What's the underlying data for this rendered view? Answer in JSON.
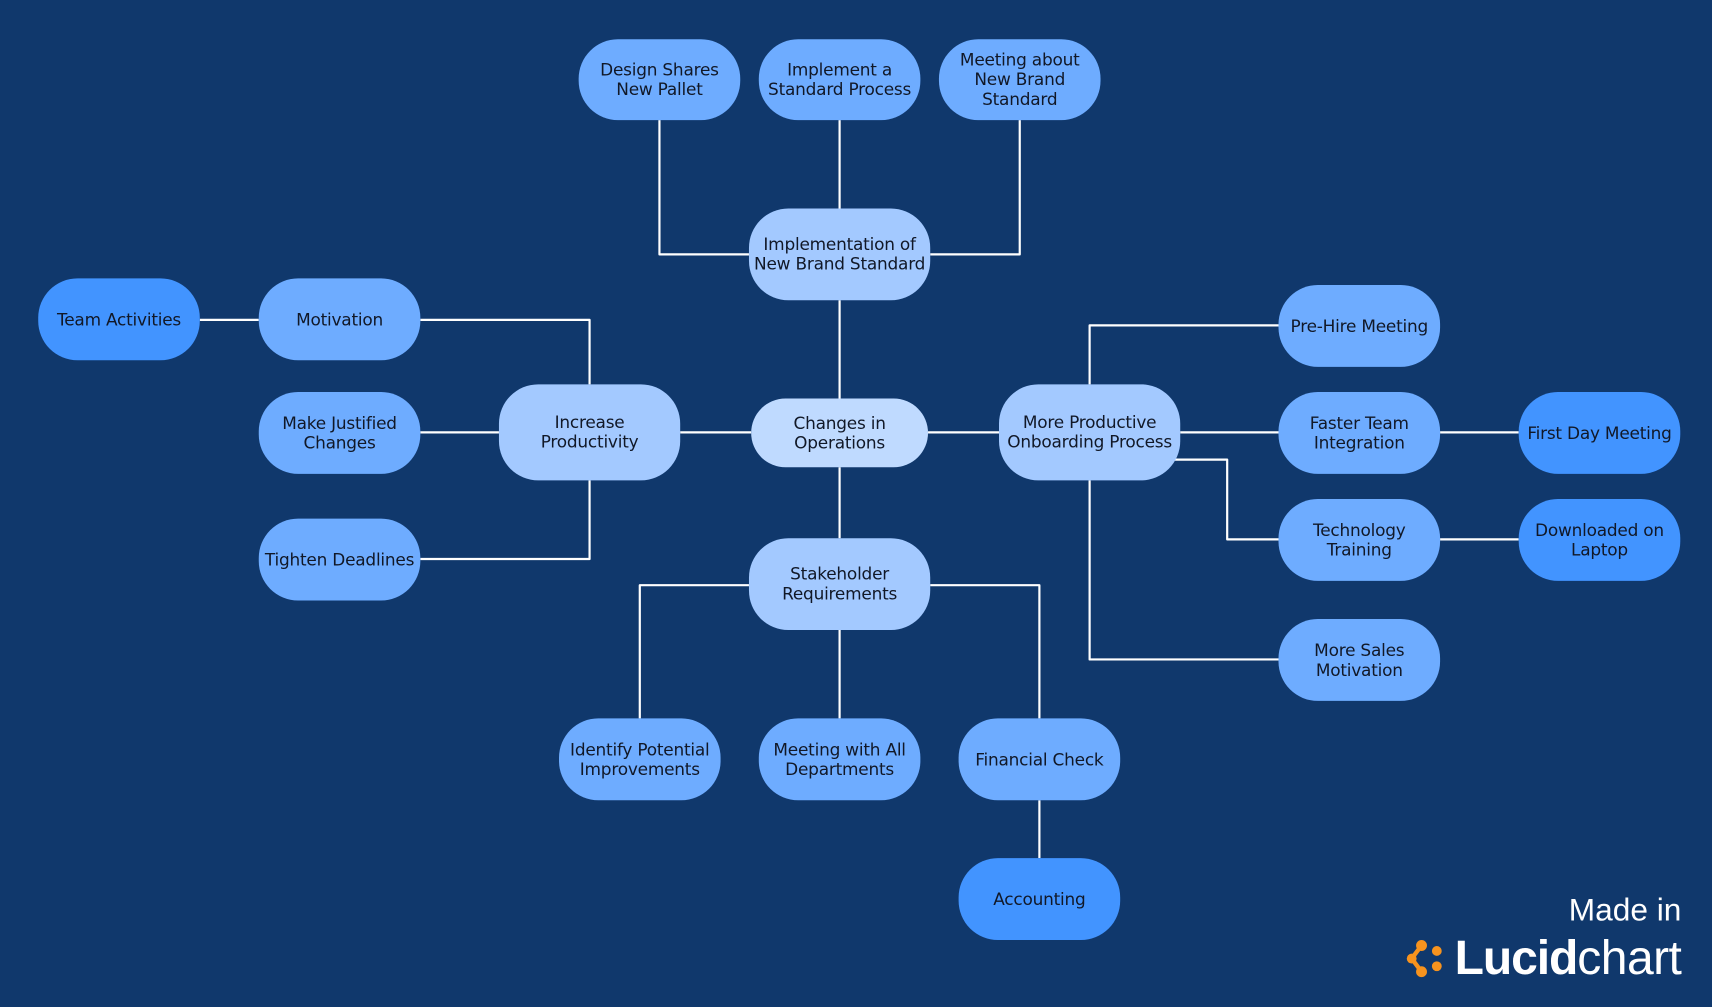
{
  "diagram": {
    "type": "mind-map",
    "colors": {
      "background": "#10386c",
      "connector": "#ffffff",
      "level0": "#bfdaff",
      "level1": "#a3c9ff",
      "level2": "#6eacff",
      "level3": "#4294ff",
      "logo_accent": "#f7931e"
    },
    "nodes": [
      {
        "id": "changes",
        "label": "Changes in\nOperations",
        "level": 0
      },
      {
        "id": "impl_brand",
        "label": "Implementation of\nNew Brand Standard",
        "level": 1
      },
      {
        "id": "design_pallet",
        "label": "Design Shares\nNew Pallet",
        "level": 2
      },
      {
        "id": "std_process",
        "label": "Implement a\nStandard Process",
        "level": 2
      },
      {
        "id": "meet_brand",
        "label": "Meeting about\nNew Brand\nStandard",
        "level": 2
      },
      {
        "id": "productivity",
        "label": "Increase Productivity",
        "level": 1
      },
      {
        "id": "motivation",
        "label": "Motivation",
        "level": 2
      },
      {
        "id": "team_act",
        "label": "Team Activities",
        "level": 3
      },
      {
        "id": "justified",
        "label": "Make Justified\nChanges",
        "level": 2
      },
      {
        "id": "deadlines",
        "label": "Tighten Deadlines",
        "level": 2
      },
      {
        "id": "onboarding",
        "label": "More Productive\nOnboarding Process",
        "level": 1
      },
      {
        "id": "prehire",
        "label": "Pre-Hire Meeting",
        "level": 2
      },
      {
        "id": "faster_team",
        "label": "Faster Team\nIntegration",
        "level": 2
      },
      {
        "id": "first_day",
        "label": "First Day Meeting",
        "level": 3
      },
      {
        "id": "tech_training",
        "label": "Technology\nTraining",
        "level": 2
      },
      {
        "id": "downloaded",
        "label": "Downloaded on\nLaptop",
        "level": 3
      },
      {
        "id": "sales_motiv",
        "label": "More Sales\nMotivation",
        "level": 2
      },
      {
        "id": "stakeholder",
        "label": "Stakeholder\nRequirements",
        "level": 1
      },
      {
        "id": "identify",
        "label": "Identify Potential\nImprovements",
        "level": 2
      },
      {
        "id": "meet_depts",
        "label": "Meeting with All\nDepartments",
        "level": 2
      },
      {
        "id": "financial",
        "label": "Financial Check",
        "level": 2
      },
      {
        "id": "accounting",
        "label": "Accounting",
        "level": 3
      }
    ],
    "edges": [
      [
        "changes",
        "impl_brand"
      ],
      [
        "impl_brand",
        "design_pallet"
      ],
      [
        "impl_brand",
        "std_process"
      ],
      [
        "impl_brand",
        "meet_brand"
      ],
      [
        "changes",
        "productivity"
      ],
      [
        "productivity",
        "motivation"
      ],
      [
        "motivation",
        "team_act"
      ],
      [
        "productivity",
        "justified"
      ],
      [
        "productivity",
        "deadlines"
      ],
      [
        "changes",
        "onboarding"
      ],
      [
        "onboarding",
        "prehire"
      ],
      [
        "onboarding",
        "faster_team"
      ],
      [
        "faster_team",
        "first_day"
      ],
      [
        "onboarding",
        "tech_training"
      ],
      [
        "tech_training",
        "downloaded"
      ],
      [
        "onboarding",
        "sales_motiv"
      ],
      [
        "changes",
        "stakeholder"
      ],
      [
        "stakeholder",
        "identify"
      ],
      [
        "stakeholder",
        "meet_depts"
      ],
      [
        "stakeholder",
        "financial"
      ],
      [
        "financial",
        "accounting"
      ]
    ]
  },
  "branding": {
    "made_in": "Made in",
    "brand_bold": "Lucid",
    "brand_light": "chart"
  }
}
